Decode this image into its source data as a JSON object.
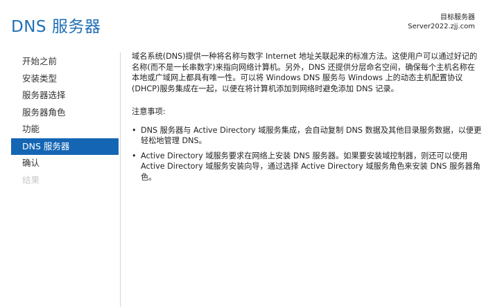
{
  "page": {
    "title": "DNS 服务器"
  },
  "target_server": {
    "label": "目标服务器",
    "name": "Server2022.zjj.com"
  },
  "sidebar": {
    "items": [
      {
        "label": "开始之前",
        "state": "normal"
      },
      {
        "label": "安装类型",
        "state": "normal"
      },
      {
        "label": "服务器选择",
        "state": "normal"
      },
      {
        "label": "服务器角色",
        "state": "normal"
      },
      {
        "label": "功能",
        "state": "normal"
      },
      {
        "label": "DNS 服务器",
        "state": "active"
      },
      {
        "label": "确认",
        "state": "normal"
      },
      {
        "label": "结果",
        "state": "disabled"
      }
    ]
  },
  "content": {
    "intro": "域名系统(DNS)提供一种将名称与数字 Internet 地址关联起来的标准方法。这使用户可以通过好记的名称(而不是一长串数字)来指向网络计算机。另外，DNS 还提供分层命名空间，确保每个主机名称在本地或广域网上都具有唯一性。可以将 Windows DNS 服务与 Windows 上的动态主机配置协议(DHCP)服务集成在一起，以便在将计算机添加到网络时避免添加 DNS 记录。",
    "notes_heading": "注意事项:",
    "bullet_glyph": "•",
    "bullets": [
      "DNS 服务器与 Active Directory 域服务集成，会自动复制 DNS 数据及其他目录服务数据，以便更轻松地管理 DNS。",
      "Active Directory 域服务要求在网络上安装 DNS 服务器。如果要安装域控制器，则还可以使用 Active Directory 域服务安装向导，通过选择 Active Directory 域服务角色来安装 DNS 服务器角色。"
    ]
  },
  "colors": {
    "title": "#1f6fb5",
    "active_nav_bg": "#1466b4",
    "disabled_nav_text": "#c8c8c8"
  }
}
